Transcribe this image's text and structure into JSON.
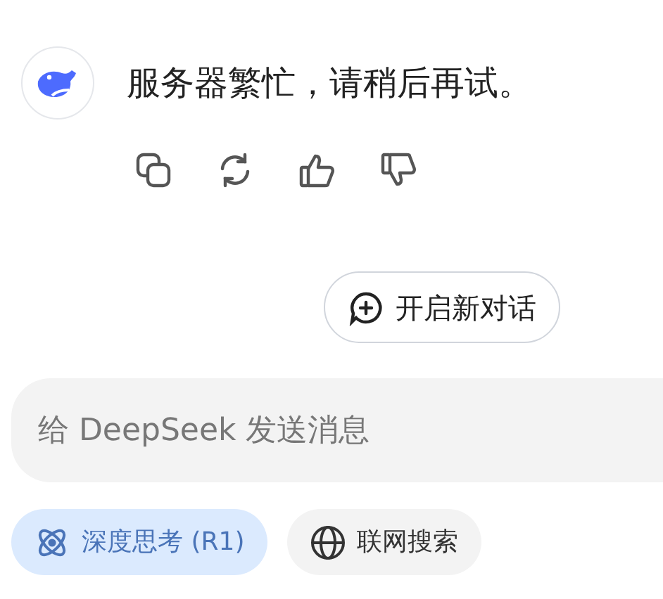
{
  "message": {
    "text": "服务器繁忙，请稍后再试。"
  },
  "new_chat_button": {
    "label": "开启新对话"
  },
  "input": {
    "placeholder": "给 DeepSeek 发送消息"
  },
  "toggles": [
    {
      "kind": "deepthink",
      "label": "深度思考 (R1)",
      "selected": true
    },
    {
      "kind": "search",
      "label": "联网搜索",
      "selected": false
    }
  ]
}
